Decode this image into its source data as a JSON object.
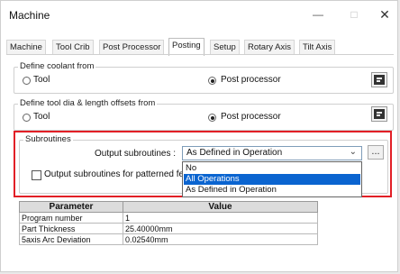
{
  "window": {
    "title": "Machine"
  },
  "window_controls": {
    "minimize": "—",
    "maximize": "□",
    "close": "✕"
  },
  "tabs": [
    "Machine",
    "Tool Crib",
    "Post Processor",
    "Posting",
    "Setup",
    "Rotary Axis",
    "Tilt Axis"
  ],
  "active_tab": "Posting",
  "coolant": {
    "legend": "Define coolant from",
    "options": [
      "Tool",
      "Post processor"
    ],
    "selected": "Post processor"
  },
  "tool_offsets": {
    "legend": "Define tool dia & length offsets from",
    "options": [
      "Tool",
      "Post processor"
    ],
    "selected": "Post processor"
  },
  "subroutines": {
    "legend": "Subroutines",
    "output_label": "Output subroutines :",
    "selected_value": "As Defined in Operation",
    "more_button": "...",
    "patterned_checkbox_label": "Output subroutines for patterned fe",
    "patterned_checked": false,
    "dropdown_options": [
      "No",
      "All Operations",
      "As Defined in Operation"
    ],
    "highlighted_option": "All Operations"
  },
  "parameters": {
    "headers": [
      "Parameter",
      "Value"
    ],
    "rows": [
      [
        "Program number",
        "1"
      ],
      [
        "Part Thickness",
        "25.40000mm"
      ],
      [
        "5axis Arc Deviation",
        "0.02540mm"
      ]
    ]
  },
  "colors": {
    "highlight_border": "#e21f26",
    "selection": "#0a64d0"
  }
}
